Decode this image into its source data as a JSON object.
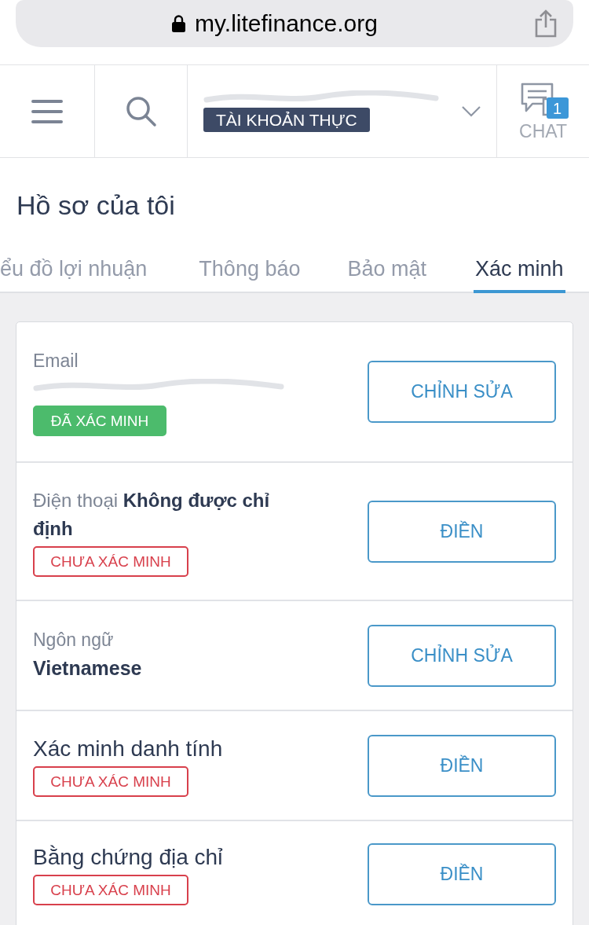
{
  "browser": {
    "url": "my.litefinance.org"
  },
  "header": {
    "account_name_redacted": true,
    "account_badge": "TÀI KHOẢN THỰC",
    "chat": {
      "label": "CHAT",
      "badge": "1"
    }
  },
  "page": {
    "title": "Hồ sơ của tôi"
  },
  "tabs": [
    {
      "label": "ểu đồ lợi nhuận",
      "selected": false
    },
    {
      "label": "Thông báo",
      "selected": false
    },
    {
      "label": "Bảo mật",
      "selected": false
    },
    {
      "label": "Xác minh",
      "selected": true
    }
  ],
  "rows": [
    {
      "kind": "stacked",
      "label": "Email",
      "value_redacted": true,
      "status": {
        "label": "ĐÃ XÁC MINH",
        "verified": true
      },
      "button": "CHỈNH SỬA"
    },
    {
      "kind": "inline",
      "text": "Điện thoại **Không được chỉ định**",
      "status": {
        "label": "CHƯA XÁC MINH",
        "verified": false
      },
      "button": "ĐIỀN"
    },
    {
      "kind": "stacked",
      "label": "Ngôn ngữ",
      "value": "Vietnamese",
      "button": "CHỈNH SỬA"
    },
    {
      "kind": "title",
      "text": "Xác minh danh tính",
      "status": {
        "label": "CHƯA XÁC MINH",
        "verified": false
      },
      "button": "ĐIỀN"
    },
    {
      "kind": "title",
      "text": "Bằng chứng địa chỉ",
      "status": {
        "label": "CHƯA XÁC MINH",
        "verified": false
      },
      "button": "ĐIỀN"
    }
  ]
}
